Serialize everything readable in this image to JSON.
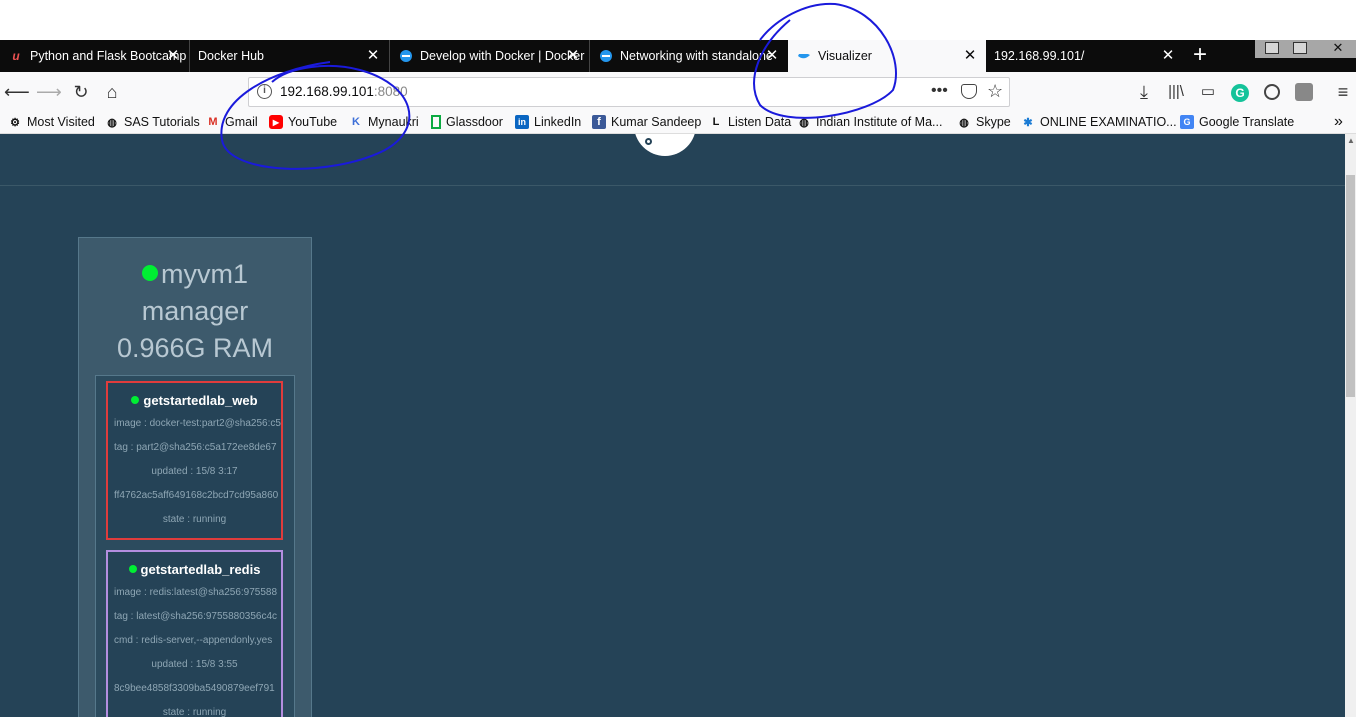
{
  "tabs": [
    {
      "label": "Python and Flask Bootcamp",
      "icon": "udemy-icon"
    },
    {
      "label": "Docker Hub",
      "icon": "docker-icon"
    },
    {
      "label": "Develop with Docker | Docker",
      "icon": "docker-icon"
    },
    {
      "label": "Networking with standalone",
      "icon": "docker-icon"
    },
    {
      "label": "Visualizer",
      "icon": "docker-icon"
    },
    {
      "label": "192.168.99.101/",
      "icon": "page-icon"
    }
  ],
  "address": {
    "host": "192.168.99.101",
    "port": ":8080"
  },
  "bookmarks": [
    {
      "label": "Most Visited",
      "icon": "gear-icon"
    },
    {
      "label": "SAS Tutorials",
      "icon": "globe-icon"
    },
    {
      "label": "Gmail",
      "icon": "gmail-icon"
    },
    {
      "label": "YouTube",
      "icon": "youtube-icon"
    },
    {
      "label": "Mynaukri",
      "icon": "naukri-icon"
    },
    {
      "label": "Glassdoor",
      "icon": "glassdoor-icon"
    },
    {
      "label": "LinkedIn",
      "icon": "linkedin-icon"
    },
    {
      "label": "Kumar Sandeep",
      "icon": "facebook-icon"
    },
    {
      "label": "Listen Data",
      "icon": "listendata-icon"
    },
    {
      "label": "Indian Institute of Ma...",
      "icon": "globe-icon"
    },
    {
      "label": "Skype",
      "icon": "globe-icon"
    },
    {
      "label": "ONLINE EXAMINATIO...",
      "icon": "exam-icon"
    },
    {
      "label": "Google Translate",
      "icon": "translate-icon"
    }
  ],
  "node": {
    "name": "myvm1",
    "role": "manager",
    "ram": "0.966G RAM"
  },
  "tasks": [
    {
      "name": "getstartedlab_web",
      "border_color": "#e03c3c",
      "lines": [
        "image : docker-test:part2@sha256:c5",
        "tag : part2@sha256:c5a172ee8de67",
        "updated : 15/8 3:17",
        "ff4762ac5aff649168c2bcd7cd95a860",
        "state : running"
      ]
    },
    {
      "name": "getstartedlab_redis",
      "border_color": "#b48ee0",
      "lines": [
        "image : redis:latest@sha256:975588",
        "tag : latest@sha256:9755880356c4c",
        "cmd : redis-server,--appendonly,yes",
        "updated : 15/8 3:55",
        "8c9bee4858f3309ba5490879eef791",
        "state : running"
      ]
    }
  ],
  "colors": {
    "background": "#254357",
    "node": "#3d5a6c",
    "running": "#00ee33",
    "annotation": "#1a1adb"
  }
}
